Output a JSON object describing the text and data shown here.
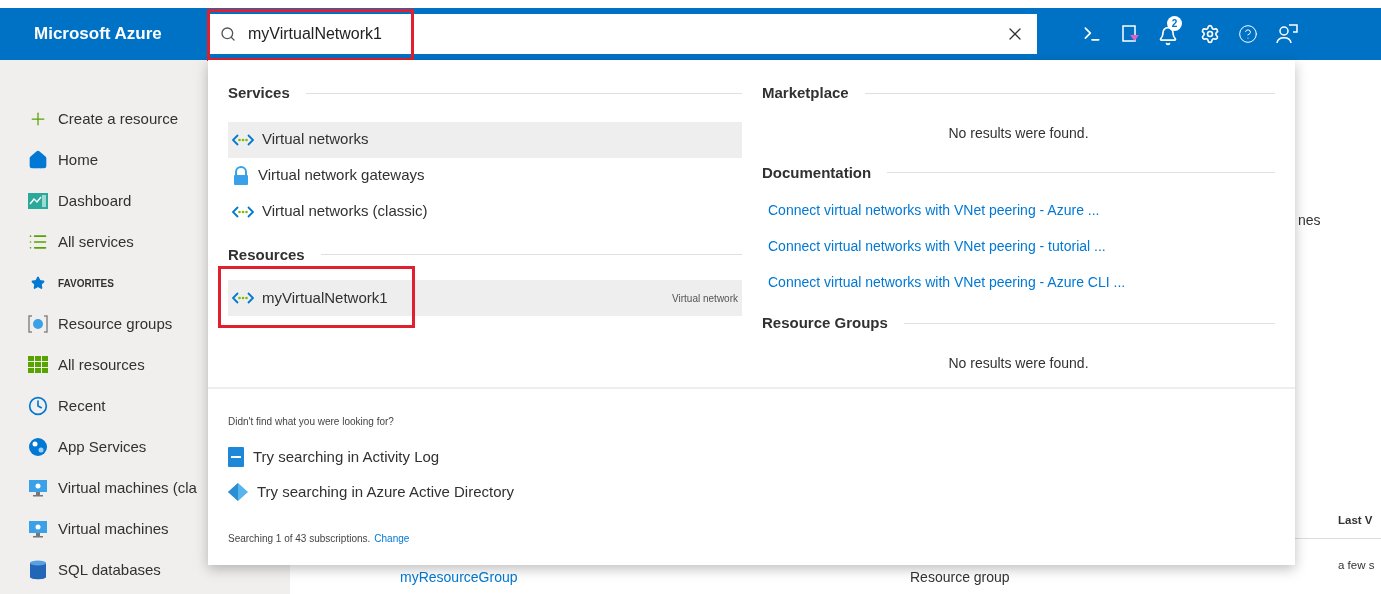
{
  "header": {
    "brand": "Microsoft Azure",
    "search": {
      "value": "myVirtualNetwork1",
      "highlighted": true
    },
    "notification_count": "2"
  },
  "sidebar": {
    "items": [
      {
        "kind": "create",
        "label": "Create a resource"
      },
      {
        "kind": "home",
        "label": "Home"
      },
      {
        "kind": "dashboard",
        "label": "Dashboard"
      },
      {
        "kind": "list",
        "label": "All services"
      },
      {
        "kind": "favorites",
        "label": "FAVORITES"
      },
      {
        "kind": "groups",
        "label": "Resource groups"
      },
      {
        "kind": "grid",
        "label": "All resources"
      },
      {
        "kind": "clock",
        "label": "Recent"
      },
      {
        "kind": "globe",
        "label": "App Services"
      },
      {
        "kind": "monitor",
        "label": "Virtual machines (cla"
      },
      {
        "kind": "monitor",
        "label": "Virtual machines"
      },
      {
        "kind": "sql",
        "label": "SQL databases"
      }
    ]
  },
  "background": {
    "text_1": "nes",
    "column_heading": "Last V",
    "row": {
      "name": "myResourceGroup",
      "type": "Resource group",
      "last_viewed": "a few s"
    }
  },
  "dropdown": {
    "services": {
      "heading": "Services",
      "items": [
        {
          "kind": "vnet",
          "label": "Virtual networks",
          "selected": true
        },
        {
          "kind": "gateway",
          "label": "Virtual network gateways",
          "selected": false
        },
        {
          "kind": "vnet",
          "label": "Virtual networks (classic)",
          "selected": false
        }
      ]
    },
    "resources": {
      "heading": "Resources",
      "items": [
        {
          "kind": "vnet",
          "label": "myVirtualNetwork1",
          "type": "Virtual network",
          "selected": true,
          "highlighted": true
        }
      ]
    },
    "marketplace": {
      "heading": "Marketplace",
      "empty": "No results were found."
    },
    "documentation": {
      "heading": "Documentation",
      "links": [
        "Connect virtual networks with VNet peering - Azure ...",
        "Connect virtual networks with VNet peering - tutorial ...",
        "Connect virtual networks with VNet peering - Azure CLI ..."
      ]
    },
    "resource_groups": {
      "heading": "Resource Groups",
      "empty": "No results were found."
    },
    "footer": {
      "prompt": "Didn't find what you were looking for?",
      "actions": [
        {
          "kind": "log",
          "label": "Try searching in Activity Log"
        },
        {
          "kind": "directory",
          "label": "Try searching in Azure Active Directory"
        }
      ],
      "status": "Searching 1 of 43 subscriptions.",
      "change_link": "Change"
    }
  }
}
